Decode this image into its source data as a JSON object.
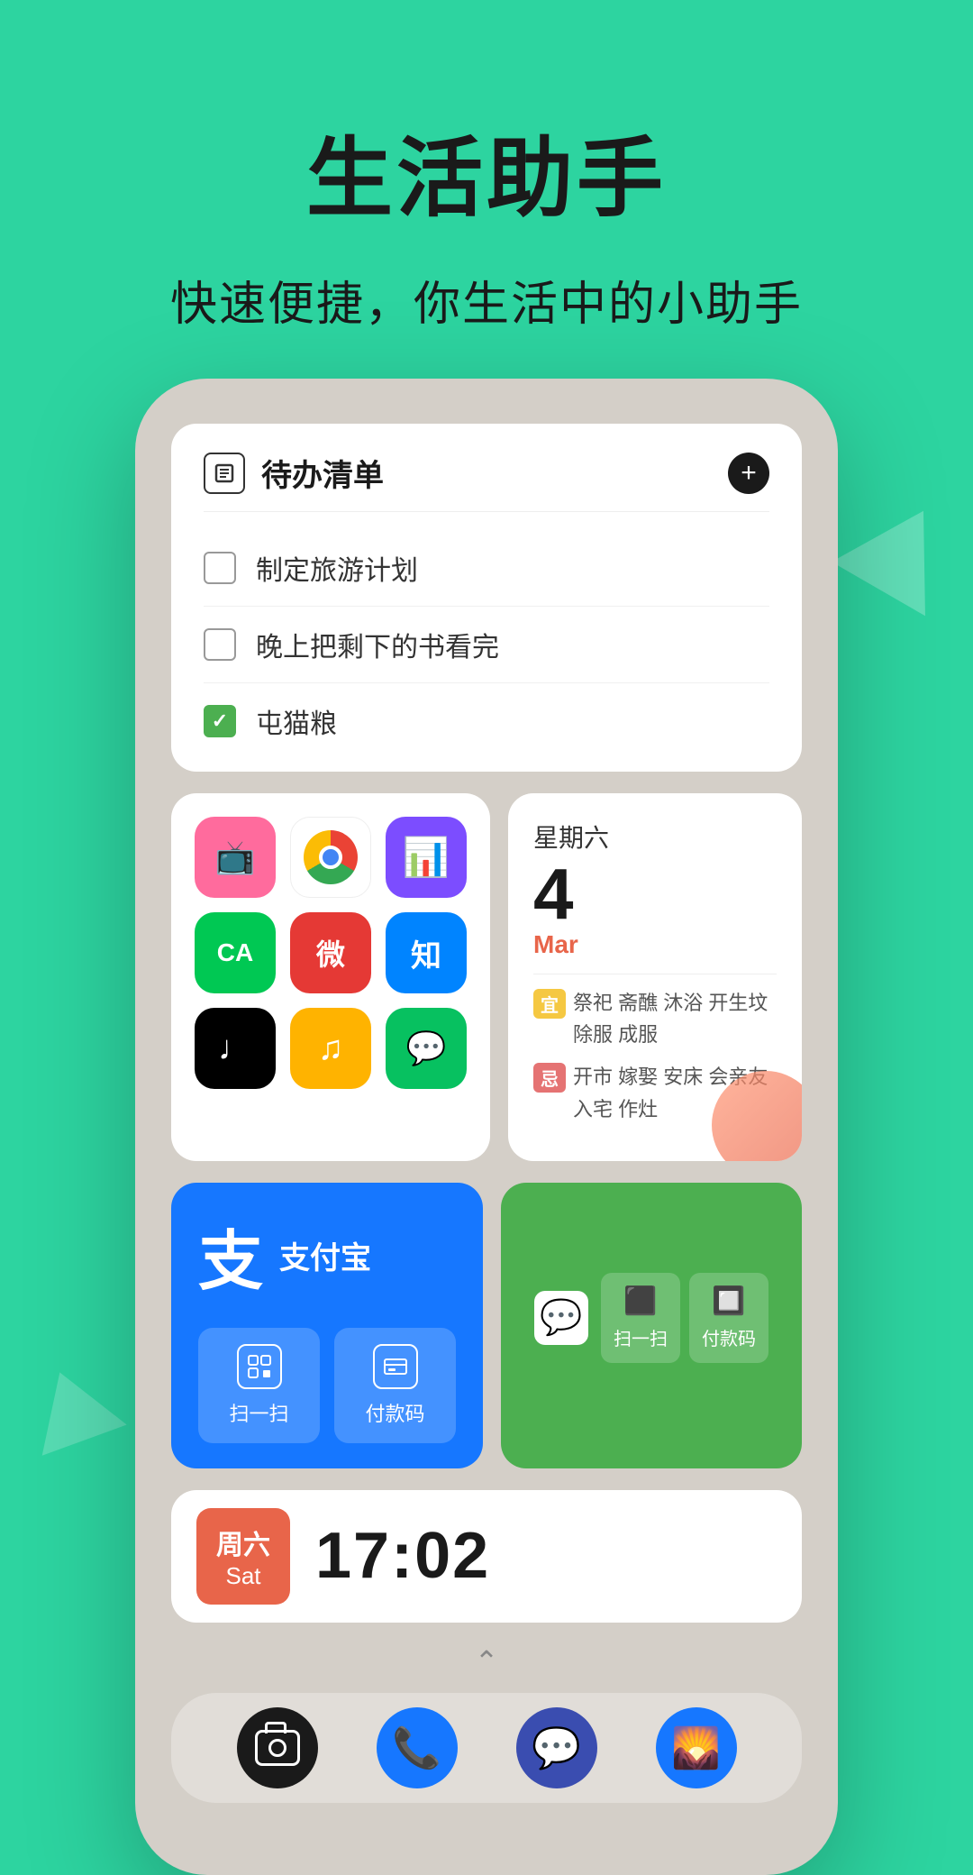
{
  "header": {
    "main_title": "生活助手",
    "subtitle": "快速便捷，你生活中的小助手"
  },
  "todo_widget": {
    "title": "待办清单",
    "add_button_label": "+",
    "items": [
      {
        "text": "制定旅游计划",
        "checked": false
      },
      {
        "text": "晚上把剩下的书看完",
        "checked": false
      },
      {
        "text": "屯猫粮",
        "checked": true
      }
    ]
  },
  "calendar_widget": {
    "date": "4",
    "day_of_week": "星期六",
    "month": "Mar",
    "auspicious_label": "宜",
    "auspicious_items": "祭祀 斋醮 沐浴 开生坟 除服 成服",
    "inauspicious_label": "忌",
    "inauspicious_items": "开市 嫁娶 安床 会亲友 入宅 作灶"
  },
  "alipay_widget": {
    "logo": "支",
    "name": "支付宝",
    "scan_label": "扫一扫",
    "pay_label": "付款码"
  },
  "wechat_widget": {
    "scan_label": "扫一扫",
    "pay_label": "付款码"
  },
  "clock_widget": {
    "day_cn": "周六",
    "day_en": "Sat",
    "time": "17:02"
  },
  "dock": {
    "items": [
      {
        "name": "camera",
        "icon": "📷"
      },
      {
        "name": "phone",
        "icon": "📞"
      },
      {
        "name": "message",
        "icon": "💬"
      },
      {
        "name": "gallery",
        "icon": "🖼"
      }
    ]
  },
  "app_icons": {
    "row1": [
      {
        "name": "tv-app",
        "color": "#FF6B9D",
        "icon": "📺"
      },
      {
        "name": "chrome",
        "color": "chrome",
        "icon": ""
      },
      {
        "name": "stats-app",
        "color": "#7C4DFF",
        "icon": "📊"
      }
    ],
    "row2": [
      {
        "name": "ca-app",
        "color": "#00C853",
        "icon": "CA"
      },
      {
        "name": "weibo",
        "color": "#E53935",
        "icon": "微"
      },
      {
        "name": "zhihu",
        "color": "#0084FF",
        "icon": "知"
      }
    ],
    "row3": [
      {
        "name": "tiktok",
        "color": "#000000",
        "icon": "♩"
      },
      {
        "name": "music",
        "color": "#FFB300",
        "icon": "♫"
      },
      {
        "name": "wechat",
        "color": "#07C160",
        "icon": "💬"
      }
    ]
  }
}
